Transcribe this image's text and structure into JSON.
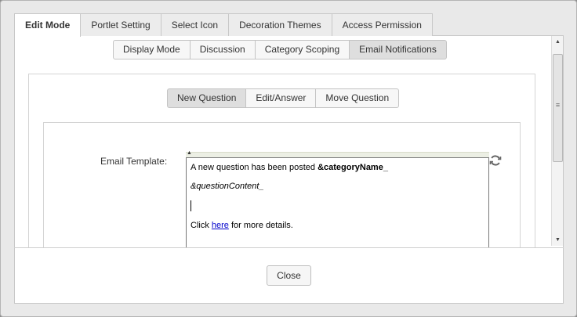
{
  "main_tabs": [
    {
      "label": "Edit Mode",
      "active": true
    },
    {
      "label": "Portlet Setting",
      "active": false
    },
    {
      "label": "Select Icon",
      "active": false
    },
    {
      "label": "Decoration Themes",
      "active": false
    },
    {
      "label": "Access Permission",
      "active": false
    }
  ],
  "sub_tabs": [
    {
      "label": "Display Mode",
      "active": false
    },
    {
      "label": "Discussion",
      "active": false
    },
    {
      "label": "Category Scoping",
      "active": false
    },
    {
      "label": "Email Notifications",
      "active": true
    }
  ],
  "question_tabs": [
    {
      "label": "New Question",
      "active": true
    },
    {
      "label": "Edit/Answer",
      "active": false
    },
    {
      "label": "Move Question",
      "active": false
    }
  ],
  "form": {
    "email_template_label": "Email Template:",
    "editor": {
      "line1_text": "A new question has been posted ",
      "line1_bold": "&categoryName_",
      "line2": "&questionContent_",
      "line4_prefix": "Click ",
      "line4_link": "here",
      "line4_suffix": " for more details."
    },
    "refresh_icon": "refresh-icon"
  },
  "footer": {
    "close_label": "Close"
  },
  "colors": {
    "link": "#0000cc",
    "active_segment": "#dedede",
    "dialog_bg": "#e9e9e9"
  }
}
